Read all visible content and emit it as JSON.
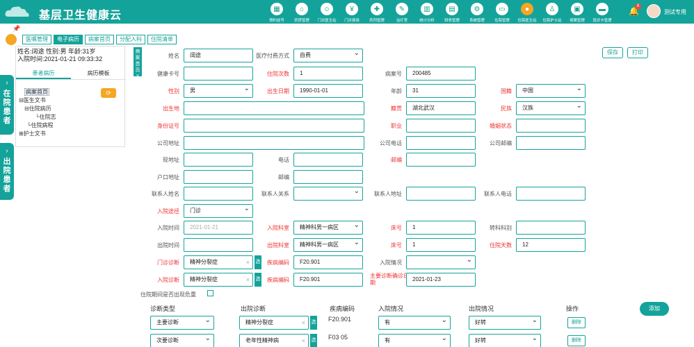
{
  "header": {
    "title": "基层卫生健康云",
    "nav": [
      {
        "label": "预约挂号",
        "icon": "calendar-icon"
      },
      {
        "label": "药房管理",
        "icon": "home-icon"
      },
      {
        "label": "门诊医生站",
        "icon": "user-icon"
      },
      {
        "label": "门诊费用",
        "icon": "yen-icon"
      },
      {
        "label": "药剂管理",
        "icon": "pill-icon"
      },
      {
        "label": "治疗室",
        "icon": "injection-icon"
      },
      {
        "label": "统计分析",
        "icon": "chart-icon"
      },
      {
        "label": "财务管理",
        "icon": "finance-icon"
      },
      {
        "label": "系统管理",
        "icon": "gear-icon"
      },
      {
        "label": "住院管理",
        "icon": "bed-icon"
      },
      {
        "label": "住院医生站",
        "icon": "doctor-icon"
      },
      {
        "label": "住院护士站",
        "icon": "nurse-icon"
      },
      {
        "label": "病案管理",
        "icon": "folder-icon"
      },
      {
        "label": "就诊卡管理",
        "icon": "card-icon"
      }
    ],
    "badge": "8",
    "username": "测试专用"
  },
  "tabs": [
    "医嘱管理",
    "电子病历",
    "病案首页",
    "分配入科",
    "住院清单"
  ],
  "side": {
    "in_hospital": "在院患者",
    "discharged": "出院患者"
  },
  "patient": {
    "line1": "姓名:阔途   性别:男   年龄:31岁",
    "line2": "入院时间:2021-01-21 09:33:32",
    "tab_records": "患者病历",
    "tab_templates": "病历模板",
    "tree": [
      "病案首页",
      "医生文书",
      "住院病历",
      "住院志",
      "住院病程",
      "护士文书"
    ]
  },
  "close_tag": "病案首页 X",
  "actions": {
    "save": "保存",
    "print": "打印"
  },
  "form": {
    "name_label": "姓名",
    "name": "阔途",
    "pay_label": "医疗付费方式",
    "pay": "自费",
    "card_label": "健康卡号",
    "card": "",
    "visits_label": "住院次数",
    "visits": "1",
    "record_label": "病案号",
    "record": "200485",
    "sex_label": "性别",
    "sex": "男",
    "birth_label": "出生日期",
    "birth": "1990-01-01",
    "age_label": "年龄",
    "age": "31",
    "nation_label": "国籍",
    "nation": "中国",
    "birthplace_label": "出生地",
    "birthplace": "",
    "native_label": "籍贯",
    "native": "湖北武汉",
    "ethnic_label": "民族",
    "ethnic": "汉族",
    "id_label": "身份证号",
    "id": "",
    "job_label": "职业",
    "job": "",
    "marital_label": "婚姻状态",
    "marital": "",
    "company_label": "公司地址",
    "company": "",
    "company_phone_label": "公司电话",
    "company_phone": "",
    "company_post_label": "公司邮编",
    "company_post": "",
    "addr_label": "现地址",
    "addr": "",
    "phone_label": "电话",
    "phone": "",
    "post_label": "邮编",
    "post": "",
    "hukou_label": "户口地址",
    "hukou": "",
    "post2_label": "邮编",
    "post2": "",
    "contact_label": "联系人姓名",
    "contact": "",
    "relation_label": "联系人关系",
    "relation": "",
    "contact_addr_label": "联系人地址",
    "contact_addr": "",
    "contact_phone_label": "联系人电话",
    "contact_phone": "",
    "route_label": "入院途径",
    "route": "门诊",
    "admit_time_label": "入院时间",
    "admit_time": "2021-01-21",
    "admit_dept_label": "入院科室",
    "admit_dept": "精神科男一病区",
    "bed_label": "床号",
    "bed": "1",
    "transfer_label": "转科科别",
    "transfer": "",
    "discharge_time_label": "出院时间",
    "discharge_time": "",
    "discharge_dept_label": "出院科室",
    "discharge_dept": "精神科男一病区",
    "bed2_label": "床号",
    "bed2": "1",
    "days_label": "住院天数",
    "days": "12",
    "op_diag_label": "门诊诊断",
    "op_diag": "精神分裂症",
    "op_code_label": "疾病编码",
    "op_code": "F20.901",
    "admit_cond_label": "入院情况",
    "admit_cond": "",
    "in_diag_label": "入院诊断",
    "in_diag": "精神分裂症",
    "in_code_label": "疾病编码",
    "in_code": "F20.901",
    "confirm_label": "主要诊断确诊日期",
    "confirm": "2021-01-23",
    "critical_label": "住院期间是否出现危重",
    "search_btn": "选"
  },
  "diag": {
    "headers": [
      "诊断类型",
      "出院诊断",
      "疾病编码",
      "入院情况",
      "出院情况",
      "操作"
    ],
    "add": "添加",
    "rows": [
      {
        "type": "主要诊断",
        "diag": "精神分裂症",
        "code": "F20.901",
        "admit": "有",
        "out": "好转",
        "op": "删除"
      },
      {
        "type": "次要诊断",
        "diag": "老年性精神病",
        "code": "F03 05",
        "admit": "有",
        "out": "好转",
        "op": "删除"
      }
    ]
  }
}
